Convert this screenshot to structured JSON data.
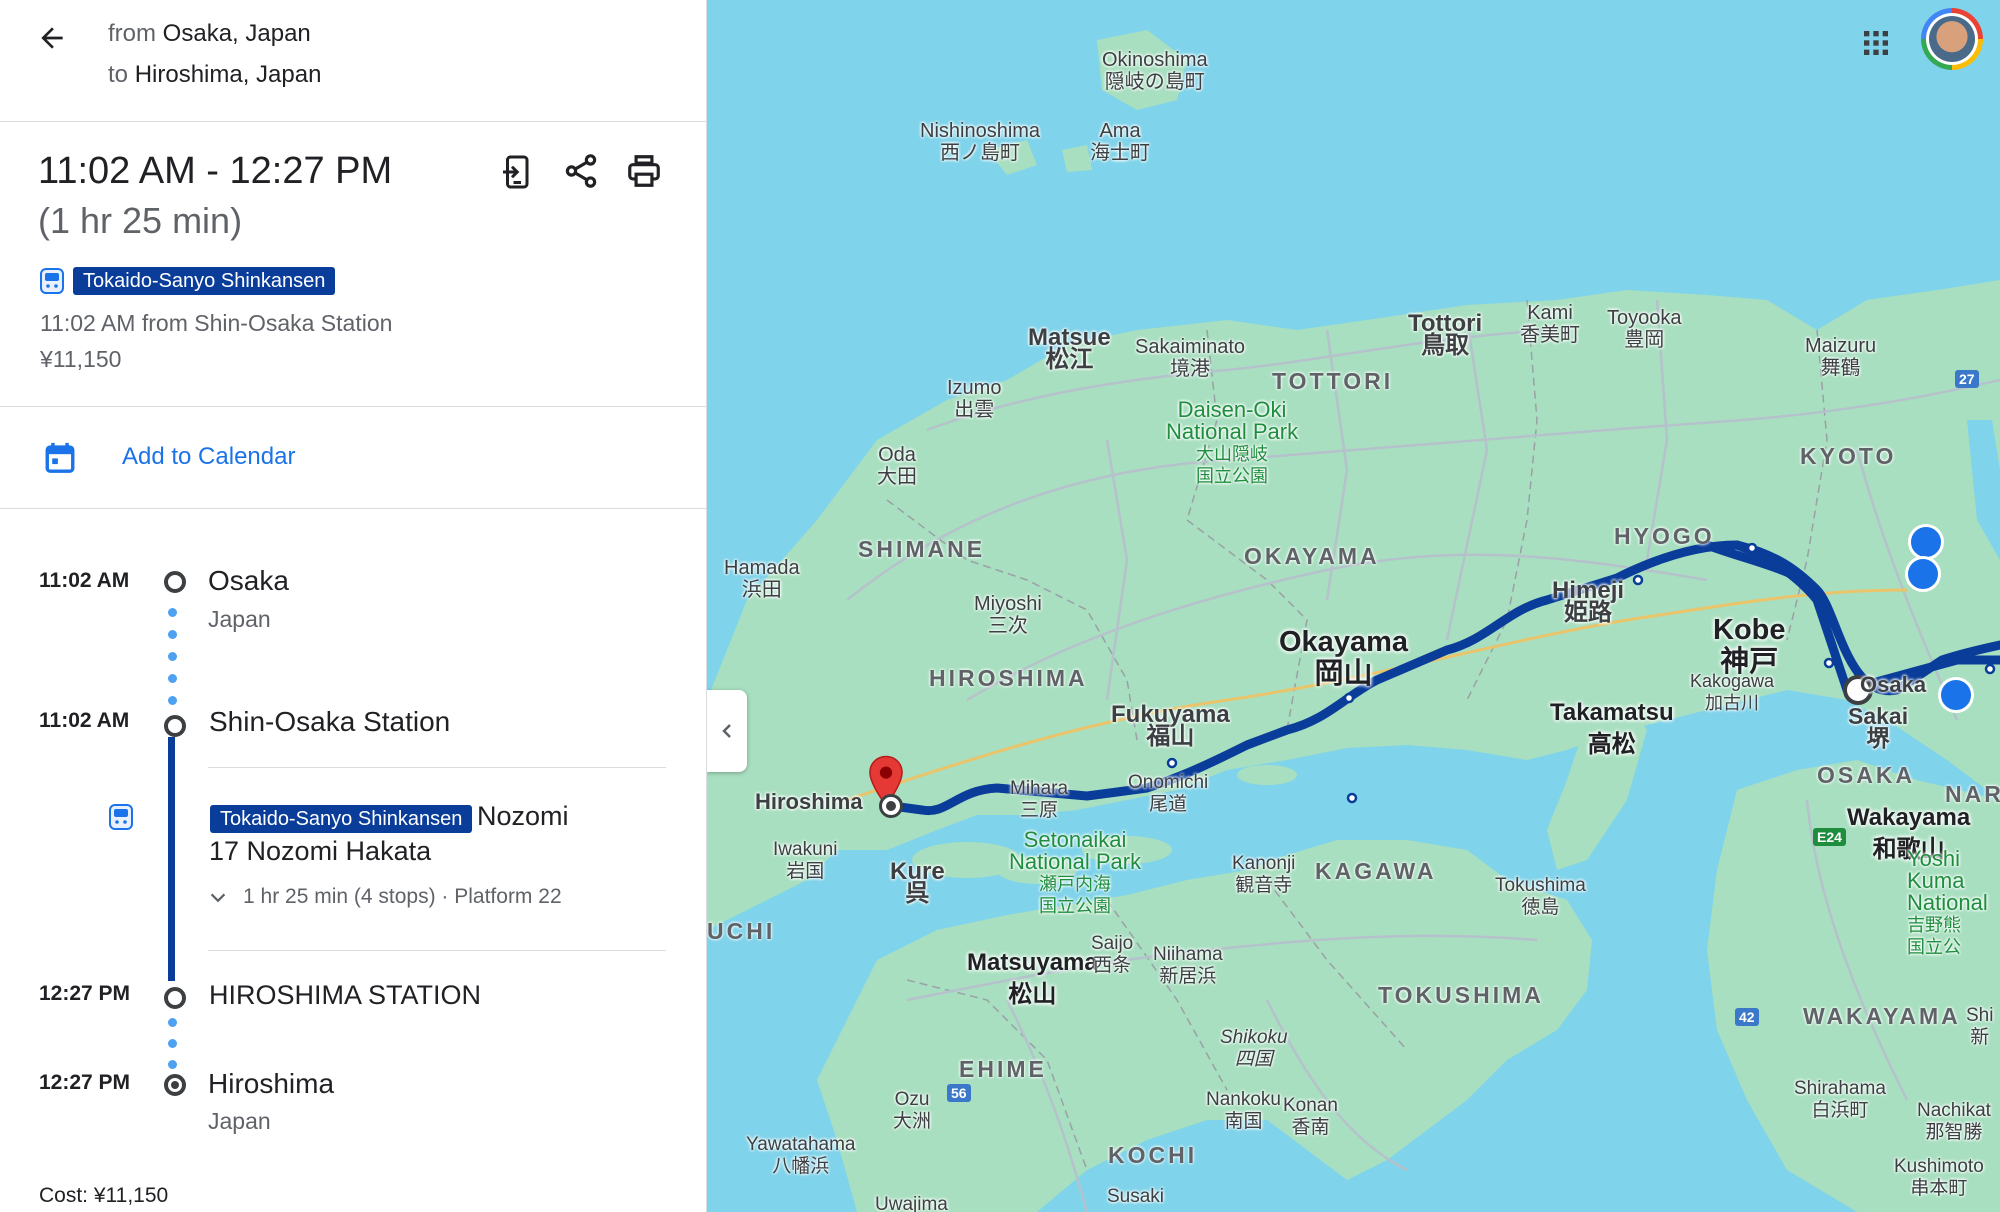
{
  "directions": {
    "from_prefix": "from",
    "from_place": "Osaka, Japan",
    "to_prefix": "to",
    "to_place": "Hiroshima, Japan"
  },
  "trip": {
    "time_range": "11:02 AM - 12:27 PM",
    "duration": "(1 hr 25 min)",
    "line_badge": "Tokaido-Sanyo Shinkansen",
    "departure_info": "11:02 AM from Shin-Osaka Station",
    "fare": "¥11,150"
  },
  "calendar": {
    "label": "Add to Calendar"
  },
  "timeline": {
    "stops": [
      {
        "time": "11:02 AM",
        "name": "Osaka",
        "sub": "Japan"
      },
      {
        "time": "11:02 AM",
        "name": "Shin-Osaka Station",
        "sub": ""
      },
      {
        "time": "12:27 PM",
        "name": "HIROSHIMA STATION",
        "sub": ""
      },
      {
        "time": "12:27 PM",
        "name": "Hiroshima",
        "sub": "Japan"
      }
    ],
    "transit": {
      "badge": "Tokaido-Sanyo Shinkansen",
      "train_suffix": "Nozomi",
      "train_line2": "17 Nozomi Hakata",
      "details": "1 hr 25 min (4 stops) · Platform 22"
    }
  },
  "cost_footer": "Cost: ¥11,150",
  "map": {
    "labels": {
      "okinoshima": "Okinoshima",
      "okinoshima_jp": "隠岐の島町",
      "nishinoshima": "Nishinoshima",
      "nishinoshima_jp": "西ノ島町",
      "ama": "Ama",
      "ama_jp": "海士町",
      "matsue": "Matsue",
      "matsue_jp": "松江",
      "sakaiminato": "Sakaiminato",
      "sakaiminato_jp": "境港",
      "izumo": "Izumo",
      "izumo_jp": "出雲",
      "oda": "Oda",
      "oda_jp": "大田",
      "hamada": "Hamada",
      "hamada_jp": "浜田",
      "miyoshi": "Miyoshi",
      "miyoshi_jp": "三次",
      "tottori": "Tottori",
      "tottori_jp": "鳥取",
      "kami": "Kami",
      "kami_jp": "香美町",
      "toyooka": "Toyooka",
      "toyooka_jp": "豊岡",
      "maizuru": "Maizuru",
      "maizuru_jp": "舞鶴",
      "daisen_1": "Daisen-Oki",
      "daisen_2": "National Park",
      "daisen_jp1": "大山隠岐",
      "daisen_jp2": "国立公園",
      "himeji": "Himeji",
      "himeji_jp": "姫路",
      "kobe": "Kobe",
      "kobe_jp": "神戸",
      "kakogawa": "Kakogawa",
      "kakogawa_jp": "加古川",
      "okayama": "Okayama",
      "okayama_jp": "岡山",
      "fukuyama": "Fukuyama",
      "fukuyama_jp": "福山",
      "onomichi": "Onomichi",
      "onomichi_jp": "尾道",
      "mihara": "Mihara",
      "mihara_jp": "三原",
      "hiroshima_city": "Hiroshima",
      "iwakuni": "Iwakuni",
      "iwakuni_jp": "岩国",
      "kure": "Kure",
      "kure_jp": "呉",
      "setonaikai_1": "Setonaikai",
      "setonaikai_2": "National Park",
      "setonaikai_jp1": "瀬戸内海",
      "setonaikai_jp2": "国立公園",
      "takamatsu": "Takamatsu",
      "takamatsu_jp": "高松",
      "kanonji": "Kanonji",
      "kanonji_jp": "観音寺",
      "tokushima": "Tokushima",
      "tokushima_jp": "徳島",
      "saijo": "Saijo",
      "saijo_jp": "西条",
      "niihama": "Niihama",
      "niihama_jp": "新居浜",
      "matsuyama": "Matsuyama",
      "matsuyama_jp": "松山",
      "shikoku": "Shikoku",
      "shikoku_jp": "四国",
      "nankoku": "Nankoku",
      "nankoku_jp": "南国",
      "konan": "Konan",
      "konan_jp": "香南",
      "ozu": "Ozu",
      "ozu_jp": "大洲",
      "yawatahama": "Yawatahama",
      "yawatahama_jp": "八幡浜",
      "susaki": "Susaki",
      "uwajima": "Uwajima",
      "osaka": "Osaka",
      "sakai": "Sakai",
      "sakai_jp": "堺",
      "wakayama": "Wakayama",
      "wakayama_jp": "和歌山",
      "shirahama": "Shirahama",
      "shirahama_jp": "白浜町",
      "nachikatsuura": "Nachikat",
      "nachikatsuura_jp": "那智勝",
      "kushimoto": "Kushimoto",
      "kushimoto_jp": "串本町",
      "yoshino_1": "Yoshi",
      "yoshino_2": "Kuma",
      "yoshino_3": "National",
      "yoshino_jp1": "吉野熊",
      "yoshino_jp2": "国立公",
      "shi": "Shi",
      "shi_jp": "新"
    },
    "prefectures": {
      "tottori": "TOTTORI",
      "shimane": "SHIMANE",
      "okayama": "OKAYAMA",
      "hyogo": "HYOGO",
      "kyoto": "KYOTO",
      "hiroshima": "HIROSHIMA",
      "kagawa": "KAGAWA",
      "tokushima": "TOKUSHIMA",
      "ehime": "EHIME",
      "kochi": "KOCHI",
      "osaka": "OSAKA",
      "nara": "NARA",
      "wakayama": "WAKAYAMA",
      "yamaguchi_partial": "UCHI"
    },
    "shields": {
      "s27": "27",
      "e24": "E24",
      "s56": "56",
      "s42": "42"
    }
  },
  "colors": {
    "route": "#0a3d9a",
    "accent": "#1a73e8",
    "water": "#7fd3ea",
    "land": "#a8dfc0",
    "pin": "#e53935"
  },
  "icons": [
    "back-arrow-icon",
    "send-to-phone-icon",
    "share-icon",
    "print-icon",
    "train-icon",
    "calendar-icon",
    "chevron-down-icon",
    "apps-grid-icon",
    "collapse-chevron-icon",
    "destination-pin-icon",
    "transit-station-icon"
  ]
}
